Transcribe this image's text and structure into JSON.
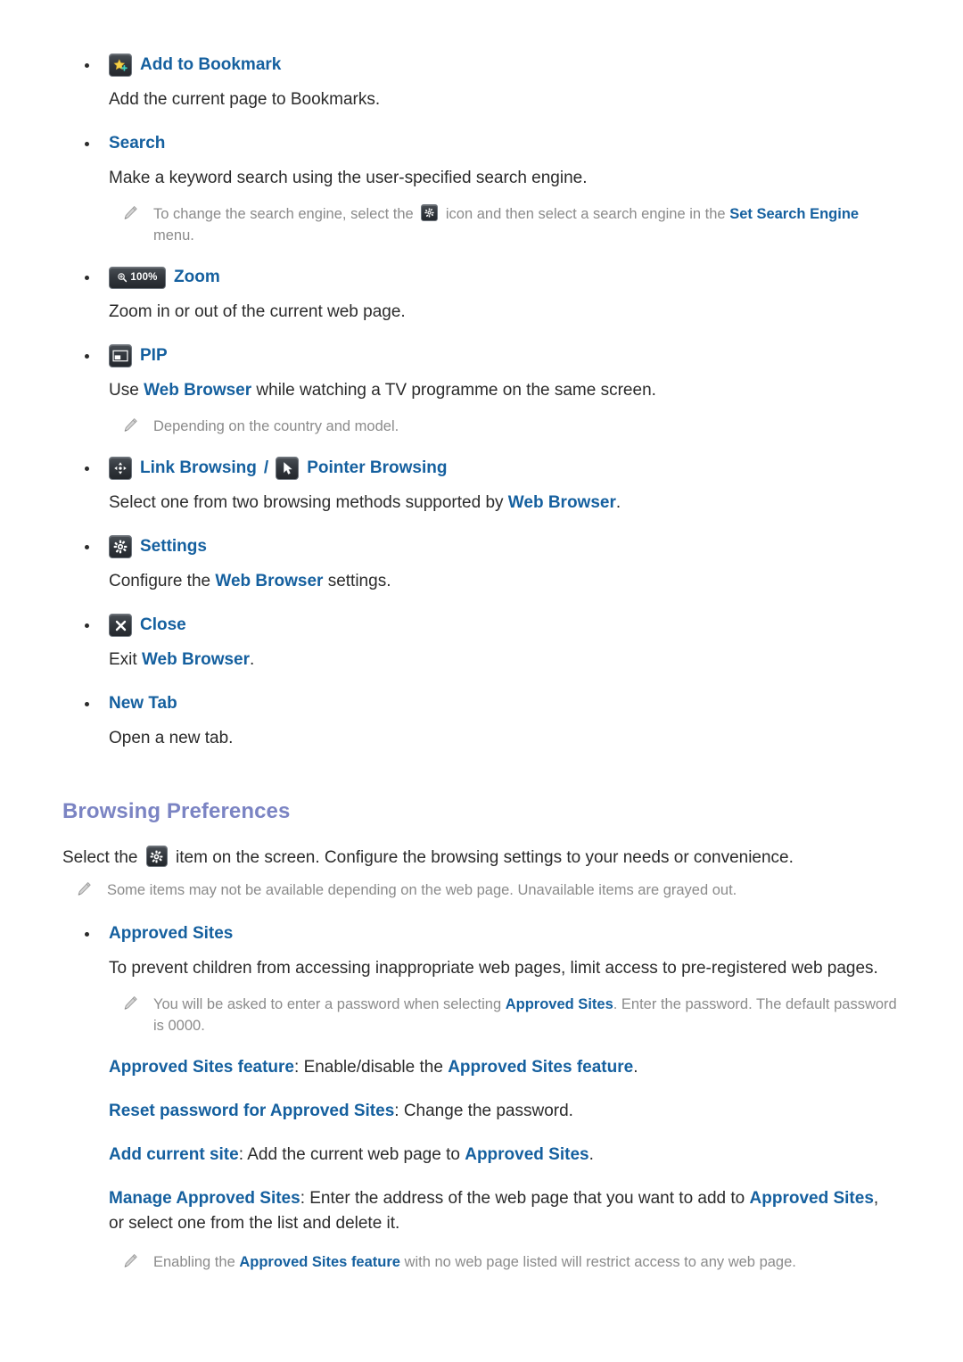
{
  "colors": {
    "link_blue": "#15609f",
    "heading_purple": "#7b84c3",
    "note_gray": "#8b8b8b",
    "body_text": "#2b2b2b",
    "icon_chip_dark": "#2c3136",
    "star_yellow": "#f6d146",
    "plus_teal": "#3ed2c0"
  },
  "menu_items": [
    {
      "icon": "add-to-bookmark-icon",
      "title": "Add to Bookmark",
      "description": "Add the current page to Bookmarks."
    },
    {
      "icon": null,
      "title": "Search",
      "description": "Make a keyword search using the user-specified search engine.",
      "note": {
        "text_before": "To change the search engine, select the ",
        "inline_icon": "gear-icon",
        "text_middle": " icon and then select a search engine in the ",
        "highlight": "Set Search Engine",
        "text_after": " menu."
      }
    },
    {
      "icon": "zoom-icon",
      "icon_label": "100%",
      "title": "Zoom",
      "description": "Zoom in or out of the current web page."
    },
    {
      "icon": "pip-icon",
      "title": "PIP",
      "description_parts": [
        {
          "text": "Use ",
          "style": "plain"
        },
        {
          "text": "Web Browser",
          "style": "link"
        },
        {
          "text": " while watching a TV programme on the same screen.",
          "style": "plain"
        }
      ],
      "note": {
        "text": "Depending on the country and model."
      }
    },
    {
      "icon": "link-browsing-icon",
      "title": "Link Browsing",
      "separator": "/",
      "icon2": "pointer-browsing-icon",
      "title2": "Pointer Browsing",
      "description_parts": [
        {
          "text": "Select one from two browsing methods supported by ",
          "style": "plain"
        },
        {
          "text": "Web Browser",
          "style": "link"
        },
        {
          "text": ".",
          "style": "plain"
        }
      ]
    },
    {
      "icon": "settings-gear-icon",
      "title": "Settings",
      "description_parts": [
        {
          "text": "Configure the ",
          "style": "plain"
        },
        {
          "text": "Web Browser",
          "style": "link"
        },
        {
          "text": " settings.",
          "style": "plain"
        }
      ]
    },
    {
      "icon": "close-x-icon",
      "title": "Close",
      "description_parts": [
        {
          "text": "Exit ",
          "style": "plain"
        },
        {
          "text": "Web Browser",
          "style": "link"
        },
        {
          "text": ".",
          "style": "plain"
        }
      ]
    },
    {
      "icon": null,
      "title": "New Tab",
      "description": "Open a new tab."
    }
  ],
  "section": {
    "heading": "Browsing Preferences",
    "intro_before": "Select the ",
    "intro_icon": "gear-icon",
    "intro_after": " item on the screen. Configure the browsing settings to your needs or convenience.",
    "intro_note": "Some items may not be available depending on the web page. Unavailable items are grayed out.",
    "bullet": {
      "title": "Approved Sites",
      "description": "To prevent children from accessing inappropriate web pages, limit access to pre-registered web pages.",
      "note_before": "You will be asked to enter a password when selecting ",
      "note_highlight": "Approved Sites",
      "note_after": ". Enter the password. The default password is 0000.",
      "options": [
        {
          "label": "Approved Sites feature",
          "sep": ": ",
          "body_before": "Enable/disable the ",
          "body_highlight": "Approved Sites feature",
          "body_after": "."
        },
        {
          "label": "Reset password for Approved Sites",
          "sep": ": ",
          "body_before": "Change the password.",
          "body_highlight": "",
          "body_after": ""
        },
        {
          "label": "Add current site",
          "sep": ": ",
          "body_before": "Add the current web page to ",
          "body_highlight": "Approved Sites",
          "body_after": "."
        },
        {
          "label": "Manage Approved Sites",
          "sep": ": ",
          "body_before": "Enter the address of the web page that you want to add to ",
          "body_highlight": "Approved Sites",
          "body_after": ", or select one from the list and delete it."
        }
      ],
      "final_note_before": "Enabling the ",
      "final_note_highlight": "Approved Sites feature",
      "final_note_after": " with no web page listed will restrict access to any web page."
    }
  }
}
